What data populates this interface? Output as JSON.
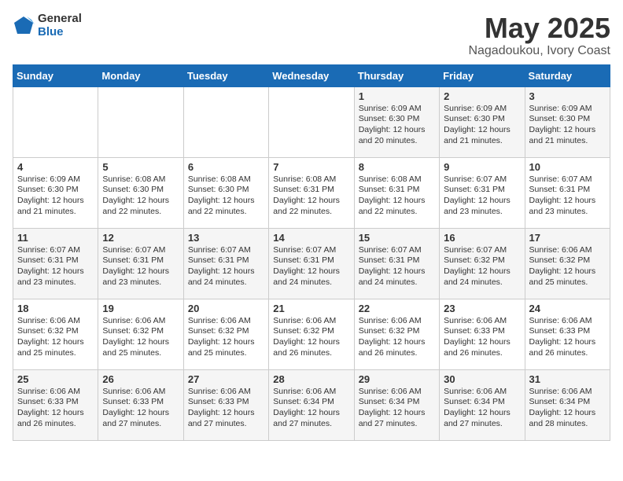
{
  "logo": {
    "general": "General",
    "blue": "Blue"
  },
  "title": "May 2025",
  "location": "Nagadoukou, Ivory Coast",
  "days_header": [
    "Sunday",
    "Monday",
    "Tuesday",
    "Wednesday",
    "Thursday",
    "Friday",
    "Saturday"
  ],
  "weeks": [
    [
      {
        "num": "",
        "lines": []
      },
      {
        "num": "",
        "lines": []
      },
      {
        "num": "",
        "lines": []
      },
      {
        "num": "",
        "lines": []
      },
      {
        "num": "1",
        "lines": [
          "Sunrise: 6:09 AM",
          "Sunset: 6:30 PM",
          "Daylight: 12 hours",
          "and 20 minutes."
        ]
      },
      {
        "num": "2",
        "lines": [
          "Sunrise: 6:09 AM",
          "Sunset: 6:30 PM",
          "Daylight: 12 hours",
          "and 21 minutes."
        ]
      },
      {
        "num": "3",
        "lines": [
          "Sunrise: 6:09 AM",
          "Sunset: 6:30 PM",
          "Daylight: 12 hours",
          "and 21 minutes."
        ]
      }
    ],
    [
      {
        "num": "4",
        "lines": [
          "Sunrise: 6:09 AM",
          "Sunset: 6:30 PM",
          "Daylight: 12 hours",
          "and 21 minutes."
        ]
      },
      {
        "num": "5",
        "lines": [
          "Sunrise: 6:08 AM",
          "Sunset: 6:30 PM",
          "Daylight: 12 hours",
          "and 22 minutes."
        ]
      },
      {
        "num": "6",
        "lines": [
          "Sunrise: 6:08 AM",
          "Sunset: 6:30 PM",
          "Daylight: 12 hours",
          "and 22 minutes."
        ]
      },
      {
        "num": "7",
        "lines": [
          "Sunrise: 6:08 AM",
          "Sunset: 6:31 PM",
          "Daylight: 12 hours",
          "and 22 minutes."
        ]
      },
      {
        "num": "8",
        "lines": [
          "Sunrise: 6:08 AM",
          "Sunset: 6:31 PM",
          "Daylight: 12 hours",
          "and 22 minutes."
        ]
      },
      {
        "num": "9",
        "lines": [
          "Sunrise: 6:07 AM",
          "Sunset: 6:31 PM",
          "Daylight: 12 hours",
          "and 23 minutes."
        ]
      },
      {
        "num": "10",
        "lines": [
          "Sunrise: 6:07 AM",
          "Sunset: 6:31 PM",
          "Daylight: 12 hours",
          "and 23 minutes."
        ]
      }
    ],
    [
      {
        "num": "11",
        "lines": [
          "Sunrise: 6:07 AM",
          "Sunset: 6:31 PM",
          "Daylight: 12 hours",
          "and 23 minutes."
        ]
      },
      {
        "num": "12",
        "lines": [
          "Sunrise: 6:07 AM",
          "Sunset: 6:31 PM",
          "Daylight: 12 hours",
          "and 23 minutes."
        ]
      },
      {
        "num": "13",
        "lines": [
          "Sunrise: 6:07 AM",
          "Sunset: 6:31 PM",
          "Daylight: 12 hours",
          "and 24 minutes."
        ]
      },
      {
        "num": "14",
        "lines": [
          "Sunrise: 6:07 AM",
          "Sunset: 6:31 PM",
          "Daylight: 12 hours",
          "and 24 minutes."
        ]
      },
      {
        "num": "15",
        "lines": [
          "Sunrise: 6:07 AM",
          "Sunset: 6:31 PM",
          "Daylight: 12 hours",
          "and 24 minutes."
        ]
      },
      {
        "num": "16",
        "lines": [
          "Sunrise: 6:07 AM",
          "Sunset: 6:32 PM",
          "Daylight: 12 hours",
          "and 24 minutes."
        ]
      },
      {
        "num": "17",
        "lines": [
          "Sunrise: 6:06 AM",
          "Sunset: 6:32 PM",
          "Daylight: 12 hours",
          "and 25 minutes."
        ]
      }
    ],
    [
      {
        "num": "18",
        "lines": [
          "Sunrise: 6:06 AM",
          "Sunset: 6:32 PM",
          "Daylight: 12 hours",
          "and 25 minutes."
        ]
      },
      {
        "num": "19",
        "lines": [
          "Sunrise: 6:06 AM",
          "Sunset: 6:32 PM",
          "Daylight: 12 hours",
          "and 25 minutes."
        ]
      },
      {
        "num": "20",
        "lines": [
          "Sunrise: 6:06 AM",
          "Sunset: 6:32 PM",
          "Daylight: 12 hours",
          "and 25 minutes."
        ]
      },
      {
        "num": "21",
        "lines": [
          "Sunrise: 6:06 AM",
          "Sunset: 6:32 PM",
          "Daylight: 12 hours",
          "and 26 minutes."
        ]
      },
      {
        "num": "22",
        "lines": [
          "Sunrise: 6:06 AM",
          "Sunset: 6:32 PM",
          "Daylight: 12 hours",
          "and 26 minutes."
        ]
      },
      {
        "num": "23",
        "lines": [
          "Sunrise: 6:06 AM",
          "Sunset: 6:33 PM",
          "Daylight: 12 hours",
          "and 26 minutes."
        ]
      },
      {
        "num": "24",
        "lines": [
          "Sunrise: 6:06 AM",
          "Sunset: 6:33 PM",
          "Daylight: 12 hours",
          "and 26 minutes."
        ]
      }
    ],
    [
      {
        "num": "25",
        "lines": [
          "Sunrise: 6:06 AM",
          "Sunset: 6:33 PM",
          "Daylight: 12 hours",
          "and 26 minutes."
        ]
      },
      {
        "num": "26",
        "lines": [
          "Sunrise: 6:06 AM",
          "Sunset: 6:33 PM",
          "Daylight: 12 hours",
          "and 27 minutes."
        ]
      },
      {
        "num": "27",
        "lines": [
          "Sunrise: 6:06 AM",
          "Sunset: 6:33 PM",
          "Daylight: 12 hours",
          "and 27 minutes."
        ]
      },
      {
        "num": "28",
        "lines": [
          "Sunrise: 6:06 AM",
          "Sunset: 6:34 PM",
          "Daylight: 12 hours",
          "and 27 minutes."
        ]
      },
      {
        "num": "29",
        "lines": [
          "Sunrise: 6:06 AM",
          "Sunset: 6:34 PM",
          "Daylight: 12 hours",
          "and 27 minutes."
        ]
      },
      {
        "num": "30",
        "lines": [
          "Sunrise: 6:06 AM",
          "Sunset: 6:34 PM",
          "Daylight: 12 hours",
          "and 27 minutes."
        ]
      },
      {
        "num": "31",
        "lines": [
          "Sunrise: 6:06 AM",
          "Sunset: 6:34 PM",
          "Daylight: 12 hours",
          "and 28 minutes."
        ]
      }
    ]
  ]
}
